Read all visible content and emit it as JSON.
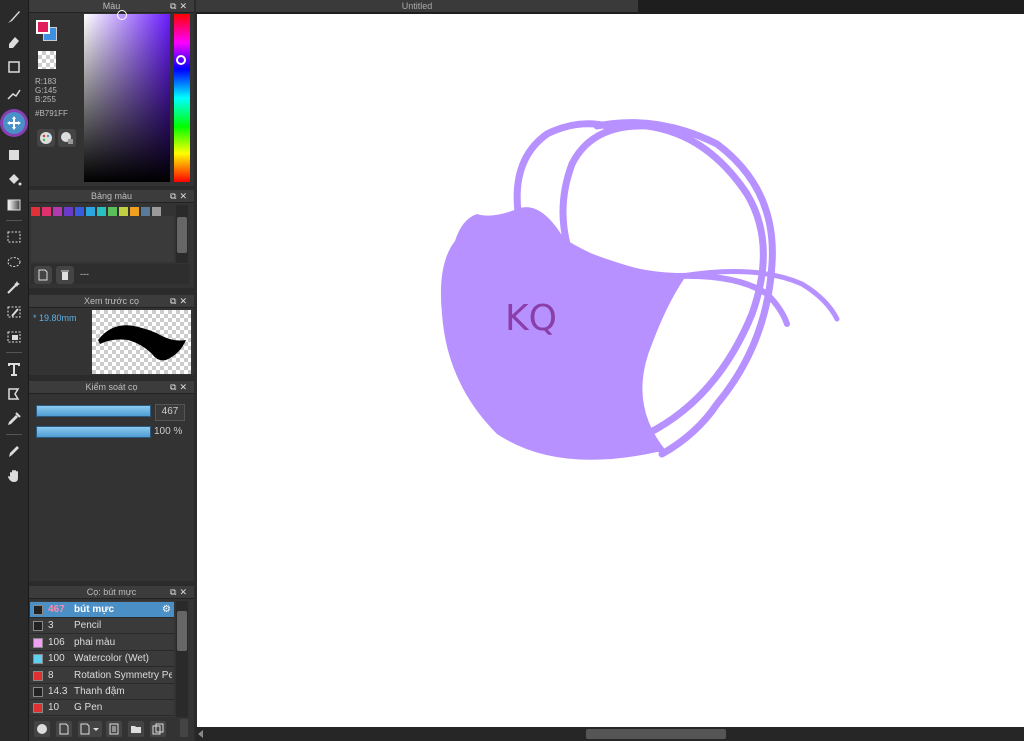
{
  "document": {
    "title": "Untitled"
  },
  "panels": {
    "color": {
      "title": "Màu",
      "r": "R:183",
      "g": "G:145",
      "b": "B:255",
      "hex": "#B791FF",
      "main_color": "#e01e5a",
      "sub_color": "#3f8fe0"
    },
    "palette": {
      "title": "Bảng màu",
      "colors": [
        "#e0303a",
        "#e0306e",
        "#b03ab0",
        "#6a3ac8",
        "#3a5ae0",
        "#2aa6e0",
        "#2ac0c0",
        "#5ac05a",
        "#c0d040",
        "#f0a020",
        "#5a7a9a",
        "#9a9a9a",
        "#3a86d8"
      ],
      "footer_text": "---"
    },
    "brush_preview": {
      "title": "Xem trước cọ",
      "size_label": "19.80mm"
    },
    "brush_control": {
      "title": "Kiểm soát cọ",
      "size_value": "467",
      "opacity_value": "100 %",
      "size_fraction": 1.0,
      "opacity_fraction": 1.0
    },
    "brush_list": {
      "title": "Cọ: bút mực",
      "items": [
        {
          "size": "467",
          "name": "bút mực",
          "color": "#222222"
        },
        {
          "size": "3",
          "name": "Pencil",
          "color": "#222222"
        },
        {
          "size": "106",
          "name": "phai màu",
          "color": "#f0a0f0"
        },
        {
          "size": "100",
          "name": "Watercolor (Wet)",
          "color": "#60d0f0"
        },
        {
          "size": "8",
          "name": "Rotation Symmetry Pe",
          "color": "#e03030"
        },
        {
          "size": "14.3",
          "name": "Thanh đậm",
          "color": "#222222"
        },
        {
          "size": "10",
          "name": "G Pen",
          "color": "#e03030"
        }
      ]
    }
  },
  "canvas": {
    "drawing_text": "KQ",
    "drawing_color": "#b791ff",
    "text_color": "#8a3fa8"
  }
}
